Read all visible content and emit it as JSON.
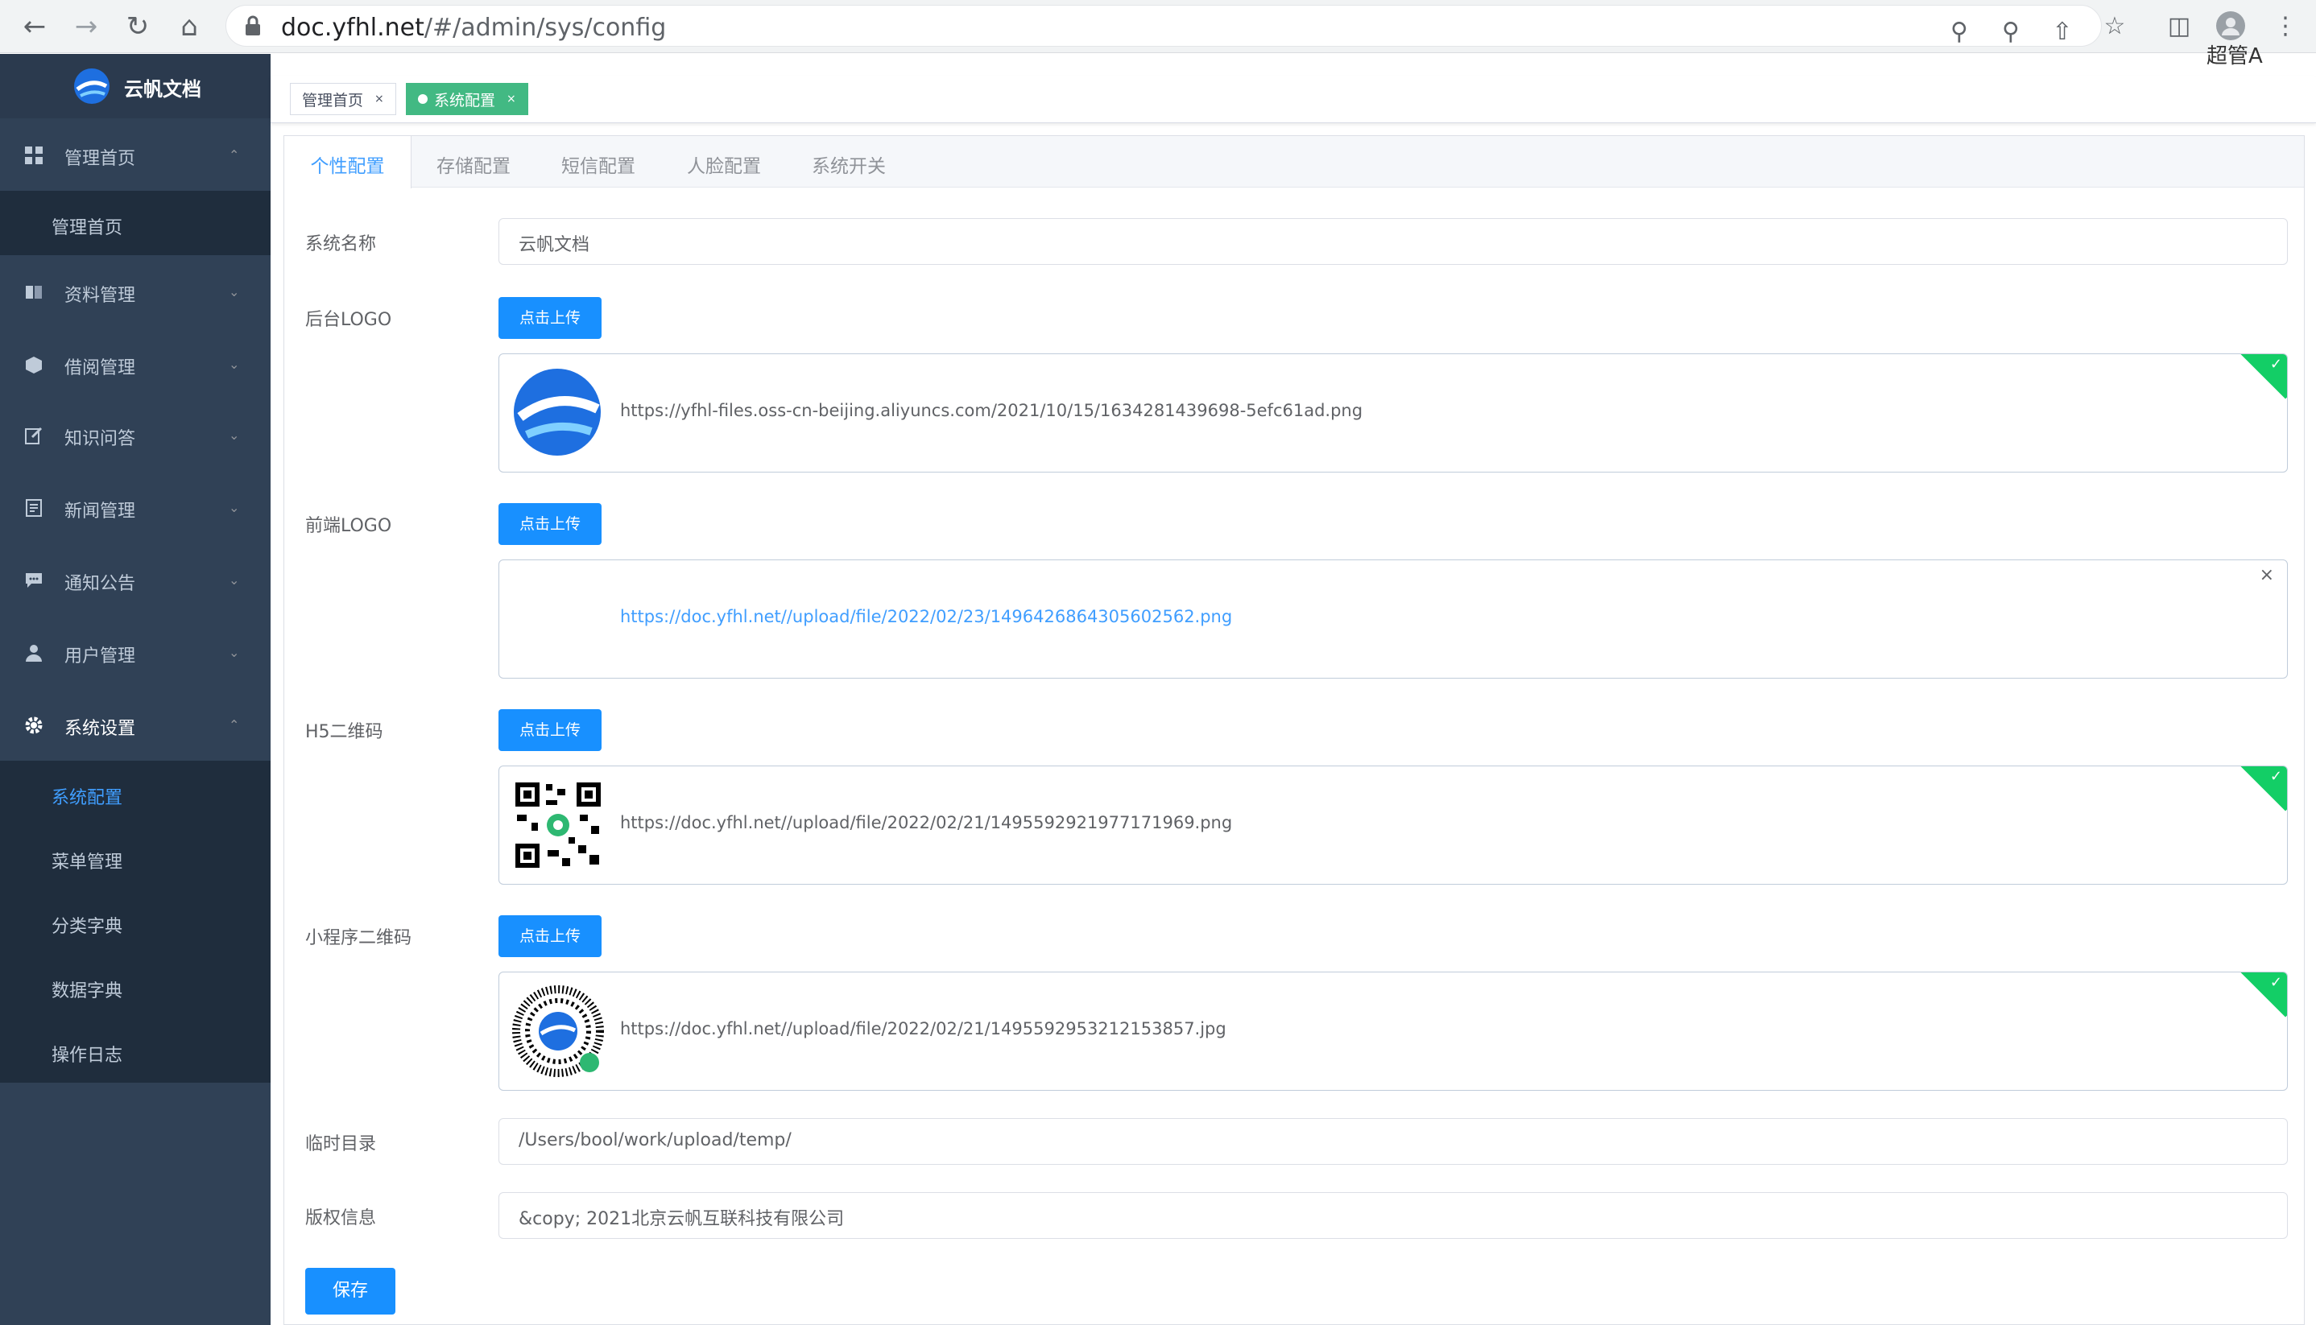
{
  "browser": {
    "url_host": "doc.yfhl.net",
    "url_path": "/#/admin/sys/config"
  },
  "sidebar": {
    "brand": "云帆文档",
    "items": [
      {
        "label": "管理首页",
        "icon": "dashboard-icon",
        "expanded": true
      },
      {
        "label": "资料管理",
        "icon": "book-icon",
        "expanded": false
      },
      {
        "label": "借阅管理",
        "icon": "box-icon",
        "expanded": false
      },
      {
        "label": "知识问答",
        "icon": "edit-icon",
        "expanded": false
      },
      {
        "label": "新闻管理",
        "icon": "news-icon",
        "expanded": false
      },
      {
        "label": "通知公告",
        "icon": "message-icon",
        "expanded": false
      },
      {
        "label": "用户管理",
        "icon": "user-icon",
        "expanded": false
      },
      {
        "label": "系统设置",
        "icon": "gear-icon",
        "expanded": true
      }
    ],
    "home_sub": [
      "管理首页"
    ],
    "system_sub": [
      "系统配置",
      "菜单管理",
      "分类字典",
      "数据字典",
      "操作日志"
    ],
    "active_sub": "系统配置"
  },
  "header": {
    "user_name": "超管A"
  },
  "tags": [
    {
      "label": "管理首页",
      "active": false
    },
    {
      "label": "系统配置",
      "active": true
    }
  ],
  "tabs": [
    "个性配置",
    "存储配置",
    "短信配置",
    "人脸配置",
    "系统开关"
  ],
  "form": {
    "site_name_label": "系统名称",
    "site_name_value": "云帆文档",
    "upload_label": "点击上传",
    "backend_logo_label": "后台LOGO",
    "backend_logo_file": "https://yfhl-files.oss-cn-beijing.aliyuncs.com/2021/10/15/1634281439698-5efc61ad.png",
    "front_logo_label": "前端LOGO",
    "front_logo_file": "https://doc.yfhl.net//upload/file/2022/02/23/1496426864305602562.png",
    "h5_qr_label": "H5二维码",
    "h5_qr_file": "https://doc.yfhl.net//upload/file/2022/02/21/1495592921977171969.png",
    "mini_qr_label": "小程序二维码",
    "mini_qr_file": "https://doc.yfhl.net//upload/file/2022/02/21/1495592953212153857.jpg",
    "temp_dir_label": "临时目录",
    "temp_dir_value": "/Users/bool/work/upload/temp/",
    "copyright_label": "版权信息",
    "copyright_value": "&copy; 2021北京云帆互联科技有限公司",
    "save_label": "保存"
  },
  "colors": {
    "sidebar_bg": "#304156",
    "primary": "#1890ff",
    "tag_active": "#42b983",
    "success": "#13ce66"
  }
}
